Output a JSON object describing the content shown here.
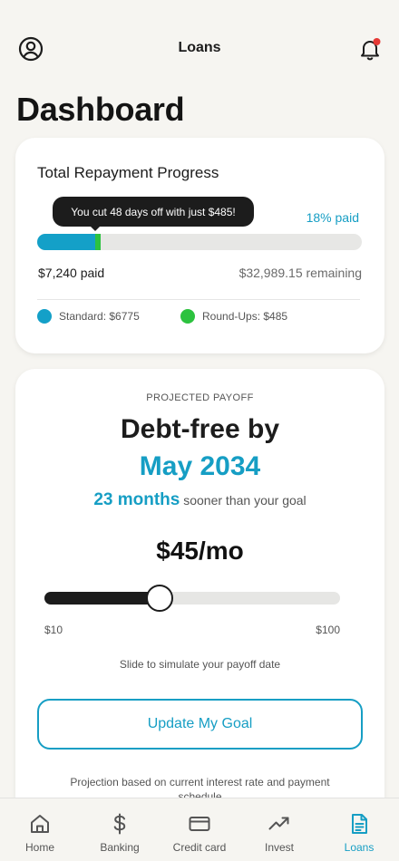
{
  "header": {
    "title": "Loans",
    "left_icon": "profile-icon",
    "right_icon": "bell-icon",
    "notification_dot_color": "#e53935"
  },
  "page_title": "Dashboard",
  "repayment": {
    "title": "Total Repayment Progress",
    "tooltip": "You cut 48 days off with just $485!",
    "percent_label": "18% paid",
    "standard_fraction": 0.18,
    "roundups_fraction": 0.015,
    "paid_label": "$7,240 paid",
    "remaining_label": "$32,989.15 remaining",
    "legend": {
      "standard_label": "Standard: $6775",
      "roundups_label": "Round-Ups: $485",
      "standard_color": "#14a0c8",
      "roundups_color": "#2cc23f"
    }
  },
  "projection": {
    "label": "PROJECTED PAYOFF",
    "debt_free_line": "Debt-free by",
    "payoff_date": "May 2034",
    "months_sooner": "23 months",
    "sooner_text": "sooner than your goal",
    "monthly_amount": "$45/mo",
    "slider": {
      "min_label": "$10",
      "max_label": "$100",
      "min": 10,
      "max": 100,
      "value": 45
    },
    "slide_hint": "Slide to simulate your payoff date",
    "goal_button": "Update My Goal",
    "footnote": "Projection based on current interest rate and payment schedule"
  },
  "tabs": [
    {
      "label": "Home",
      "icon": "home-icon",
      "active": false
    },
    {
      "label": "Banking",
      "icon": "dollar-icon",
      "active": false
    },
    {
      "label": "Credit card",
      "icon": "credit-card-icon",
      "active": false
    },
    {
      "label": "Invest",
      "icon": "trending-up-icon",
      "active": false
    },
    {
      "label": "Loans",
      "icon": "document-icon",
      "active": true
    }
  ],
  "colors": {
    "accent": "#169ec4",
    "background": "#f6f5f1"
  }
}
